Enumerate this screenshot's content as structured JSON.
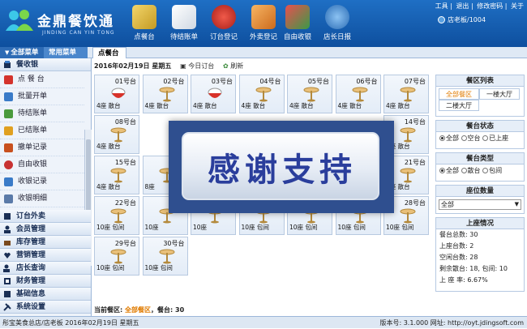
{
  "app": {
    "logo_title": "金鼎餐饮通",
    "logo_subtitle": "JINDING CAN YIN TONG"
  },
  "nav": [
    {
      "label": "点餐台",
      "icon": "order-desk-icon",
      "color": "#e9c24a"
    },
    {
      "label": "待结账单",
      "icon": "pending-bill-icon",
      "color": "#f2f2f2"
    },
    {
      "label": "订台登记",
      "icon": "phone-icon",
      "color": "#d4332c"
    },
    {
      "label": "外卖登记",
      "icon": "takeout-icon",
      "color": "#e8963a"
    },
    {
      "label": "自由收银",
      "icon": "cashier-icon",
      "color": "#3b9a48"
    },
    {
      "label": "店长日报",
      "icon": "manager-report-icon",
      "color": "#4a93d8"
    }
  ],
  "top_links": [
    "工具",
    "退出",
    "修改密码",
    "关于"
  ],
  "user": "店老板/1004",
  "tabs": {
    "all_menu": "全部菜单",
    "common_menu": "常用菜单",
    "order_tab": "点餐台"
  },
  "sidebar": {
    "sections": [
      {
        "label": "餐收银",
        "icon": "cash-register-icon"
      },
      {
        "label": "订台外卖",
        "icon": "booking-icon"
      },
      {
        "label": "会员管理",
        "icon": "member-icon"
      },
      {
        "label": "库存管理",
        "icon": "inventory-icon"
      },
      {
        "label": "营销管理",
        "icon": "marketing-icon"
      },
      {
        "label": "店长查询",
        "icon": "query-icon"
      },
      {
        "label": "财务管理",
        "icon": "finance-icon"
      },
      {
        "label": "基础信息",
        "icon": "info-icon"
      },
      {
        "label": "系统设置",
        "icon": "settings-icon"
      }
    ],
    "items": [
      {
        "label": "点 餐 台",
        "icon": "order-icon",
        "color": "#d4332c"
      },
      {
        "label": "批量开单",
        "icon": "batch-open-icon",
        "color": "#3a7bc8"
      },
      {
        "label": "待结账单",
        "icon": "pending-bill-icon",
        "color": "#4a9a3c"
      },
      {
        "label": "已结账单",
        "icon": "settled-bill-icon",
        "color": "#e0a020"
      },
      {
        "label": "撤单记录",
        "icon": "cancel-record-icon",
        "color": "#c8501e"
      },
      {
        "label": "自由收银",
        "icon": "free-cashier-icon",
        "color": "#c83232"
      },
      {
        "label": "收银记录",
        "icon": "cash-record-icon",
        "color": "#3a7bc8"
      },
      {
        "label": "收银明细",
        "icon": "cash-detail-icon",
        "color": "#5a7aa8"
      }
    ]
  },
  "datebar": {
    "date": "2016年02月19日  星期五",
    "today_booking": "今日订台",
    "refresh": "刷新"
  },
  "tables": [
    {
      "no": "01号台",
      "label": "4座  散台",
      "status": "busy"
    },
    {
      "no": "02号台",
      "label": "4座  散台",
      "status": "free"
    },
    {
      "no": "03号台",
      "label": "4座  散台",
      "status": "busy"
    },
    {
      "no": "04号台",
      "label": "4座  散台",
      "status": "free"
    },
    {
      "no": "05号台",
      "label": "4座  散台",
      "status": "free"
    },
    {
      "no": "06号台",
      "label": "4座  散台",
      "status": "free"
    },
    {
      "no": "07号台",
      "label": "4座  散台",
      "status": "free"
    },
    {
      "no": "08号台",
      "label": "4座  散台",
      "status": "free"
    },
    {
      "no": "",
      "label": "",
      "status": "hidden"
    },
    {
      "no": "",
      "label": "",
      "status": "hidden"
    },
    {
      "no": "",
      "label": "",
      "status": "hidden"
    },
    {
      "no": "",
      "label": "",
      "status": "hidden"
    },
    {
      "no": "",
      "label": "",
      "status": "hidden"
    },
    {
      "no": "14号台",
      "label": "4座  散台",
      "status": "free"
    },
    {
      "no": "15号台",
      "label": "4座  散台",
      "status": "free"
    },
    {
      "no": "",
      "label": "8座",
      "status": "hidden"
    },
    {
      "no": "",
      "label": "",
      "status": "hidden"
    },
    {
      "no": "",
      "label": "",
      "status": "hidden"
    },
    {
      "no": "",
      "label": "",
      "status": "hidden"
    },
    {
      "no": "",
      "label": "",
      "status": "hidden"
    },
    {
      "no": "21号台",
      "label": "4座  散台",
      "status": "free"
    },
    {
      "no": "22号台",
      "label": "10座  包间",
      "status": "free"
    },
    {
      "no": "",
      "label": "10座",
      "status": "hidden"
    },
    {
      "no": "",
      "label": "10座",
      "status": "free"
    },
    {
      "no": "",
      "label": "10座  包间",
      "status": "free"
    },
    {
      "no": "",
      "label": "10座  包间",
      "status": "free"
    },
    {
      "no": "",
      "label": "10座  包间",
      "status": "free"
    },
    {
      "no": "28号台",
      "label": "10座  包间",
      "status": "free"
    },
    {
      "no": "29号台",
      "label": "10座  包间",
      "status": "free"
    },
    {
      "no": "30号台",
      "label": "10座  包间",
      "status": "free"
    }
  ],
  "watermark": "感谢支持",
  "right_panel": {
    "zone_title": "餐区列表",
    "zones": [
      "全部餐区",
      "一楼大厅",
      "二楼大厅"
    ],
    "status_title": "餐台状态",
    "status_options": [
      "全部",
      "空台",
      "已上座"
    ],
    "type_title": "餐台类型",
    "type_options": [
      "全部",
      "散台",
      "包间"
    ],
    "seat_title": "座位数量",
    "seat_value": "全部",
    "occupancy_title": "上座情况",
    "stats": [
      "餐台总数: 30",
      "上座台数: 2",
      "空闲台数: 28",
      "剩余散台: 18, 包间: 10",
      "上 座 率: 6.67%"
    ]
  },
  "statusbar": {
    "prefix": "当前餐区:",
    "zone": "全部餐区",
    "count_label": "，餐台:",
    "count": "30"
  },
  "footer": {
    "left": "彤宝美食总店/店老板    2016年02月19日    星期五",
    "right": "版本号: 3.1.000  网址: http://oyt.jdingsoft.com"
  }
}
